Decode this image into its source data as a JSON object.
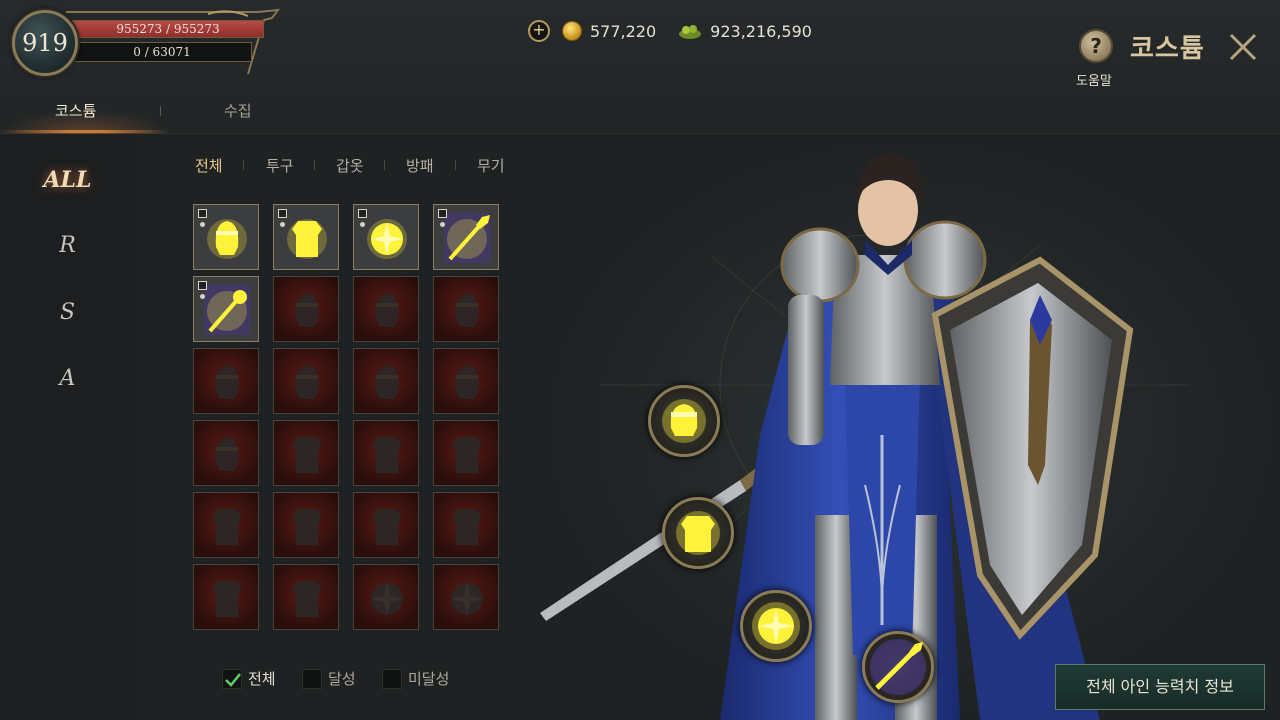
{
  "player": {
    "level": "919",
    "hp": "955273 / 955273",
    "exp": "0 / 63071"
  },
  "currency": {
    "gold": "577,220",
    "gems": "923,216,590"
  },
  "header": {
    "title": "코스튬",
    "help_label": "도움말"
  },
  "tabs": [
    {
      "label": "코스튬",
      "active": true
    },
    {
      "label": "수집",
      "active": false
    }
  ],
  "ranks": [
    {
      "label": "ALL",
      "active": true
    },
    {
      "label": "R",
      "active": false
    },
    {
      "label": "S",
      "active": false
    },
    {
      "label": "A",
      "active": false
    }
  ],
  "categories": [
    {
      "label": "전체",
      "active": true
    },
    {
      "label": "투구",
      "active": false
    },
    {
      "label": "갑옷",
      "active": false
    },
    {
      "label": "방패",
      "active": false
    },
    {
      "label": "무기",
      "active": false
    }
  ],
  "grid": {
    "items": [
      {
        "icon": "helmet-icon",
        "style": "gold"
      },
      {
        "icon": "armor-icon",
        "style": "gold"
      },
      {
        "icon": "shield-icon",
        "style": "gold"
      },
      {
        "icon": "spear-icon",
        "style": "gold"
      },
      {
        "icon": "scepter-icon",
        "style": "gold"
      },
      {
        "icon": "helmet-icon",
        "style": "dark"
      },
      {
        "icon": "helmet-icon",
        "style": "dark"
      },
      {
        "icon": "helmet-icon",
        "style": "dark"
      },
      {
        "icon": "helmet-icon",
        "style": "dark"
      },
      {
        "icon": "helmet-icon",
        "style": "dark"
      },
      {
        "icon": "helmet-icon",
        "style": "dark"
      },
      {
        "icon": "helmet-icon",
        "style": "dark"
      },
      {
        "icon": "helmet-icon",
        "style": "dark"
      },
      {
        "icon": "armor-icon",
        "style": "dark"
      },
      {
        "icon": "armor-icon",
        "style": "dark"
      },
      {
        "icon": "armor-icon",
        "style": "dark"
      },
      {
        "icon": "armor-icon",
        "style": "dark"
      },
      {
        "icon": "armor-icon",
        "style": "dark"
      },
      {
        "icon": "armor-icon",
        "style": "dark"
      },
      {
        "icon": "armor-icon",
        "style": "dark"
      },
      {
        "icon": "armor-icon",
        "style": "dark"
      },
      {
        "icon": "armor-icon",
        "style": "dark"
      },
      {
        "icon": "shield-icon",
        "style": "dark"
      },
      {
        "icon": "shield-icon",
        "style": "dark"
      }
    ]
  },
  "filters": [
    {
      "label": "전체",
      "checked": true
    },
    {
      "label": "달성",
      "checked": false
    },
    {
      "label": "미달성",
      "checked": false
    }
  ],
  "equipped": [
    {
      "icon": "helmet-icon"
    },
    {
      "icon": "armor-icon"
    },
    {
      "icon": "shield-icon"
    },
    {
      "icon": "spear-icon"
    }
  ],
  "stat_button": "전체 아인 능력치 정보",
  "colors": {
    "accent_gold": "#e6c98a",
    "glow_yellow": "#fff23a",
    "cloak_blue": "#2a3f9c",
    "hp_red": "#b84a45"
  }
}
